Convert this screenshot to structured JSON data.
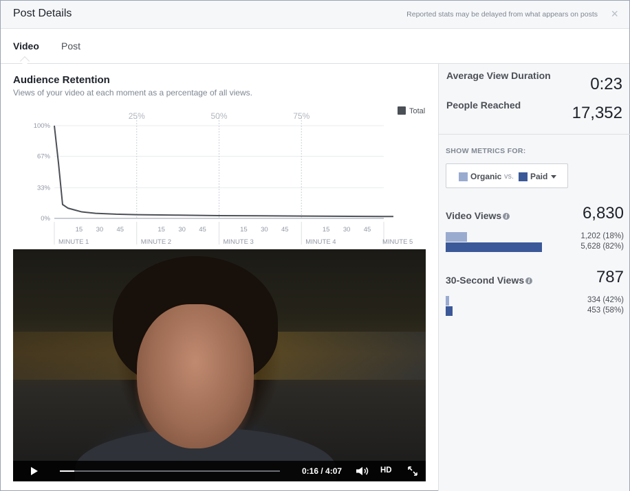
{
  "header": {
    "title": "Post Details",
    "note": "Reported stats may be delayed from what appears on posts",
    "close_glyph": "×"
  },
  "tabs": [
    {
      "label": "Video",
      "active": true
    },
    {
      "label": "Post",
      "active": false
    }
  ],
  "retention": {
    "title": "Audience Retention",
    "subtitle": "Views of your video at each moment as a percentage of all views."
  },
  "chart_data": {
    "type": "line",
    "title": "",
    "xlabel": "",
    "ylabel": "",
    "y_ticks": [
      "100%",
      "67%",
      "33%",
      "0%"
    ],
    "ylim": [
      0,
      100
    ],
    "x_second_ticks": [
      "15",
      "30",
      "45"
    ],
    "x_minute_labels": [
      "MINUTE 1",
      "MINUTE 2",
      "MINUTE 3",
      "MINUTE 4",
      "MINUTE 5"
    ],
    "quartile_markers": [
      "25%",
      "50%",
      "75%"
    ],
    "legend_position": "top-right",
    "series": [
      {
        "name": "Total",
        "color": "#4b4f56",
        "x": [
          0,
          3,
          6,
          10,
          15,
          20,
          30,
          45,
          60,
          90,
          120,
          180,
          240,
          247
        ],
        "y": [
          100,
          60,
          15,
          11,
          9,
          7,
          5.5,
          4.5,
          4,
          3.5,
          3,
          2.5,
          2,
          2
        ]
      }
    ],
    "grid": true
  },
  "video": {
    "time": "0:16 / 4:07",
    "progress": 0.065,
    "hd_label": "HD"
  },
  "stats": {
    "avg_view_duration_label": "Average View Duration",
    "avg_view_duration_value": "0:23",
    "people_reached_label": "People Reached",
    "people_reached_value": "17,352"
  },
  "metrics": {
    "label": "SHOW METRICS FOR:",
    "organic_label": "Organic",
    "vs_label": "vs.",
    "paid_label": "Paid",
    "organic_color": "#9aabd0",
    "paid_color": "#3b5998"
  },
  "video_views": {
    "title": "Video Views",
    "total": "6,830",
    "organic_text": "1,202  (18%)",
    "paid_text": "5,628  (82%)",
    "organic_fraction": 0.18,
    "paid_fraction": 0.82
  },
  "thirty_sec_views": {
    "title": "30-Second Views",
    "total": "787",
    "organic_text": "334  (42%)",
    "paid_text": "453  (58%)",
    "organic_fraction": 0.42,
    "paid_fraction": 0.58
  }
}
